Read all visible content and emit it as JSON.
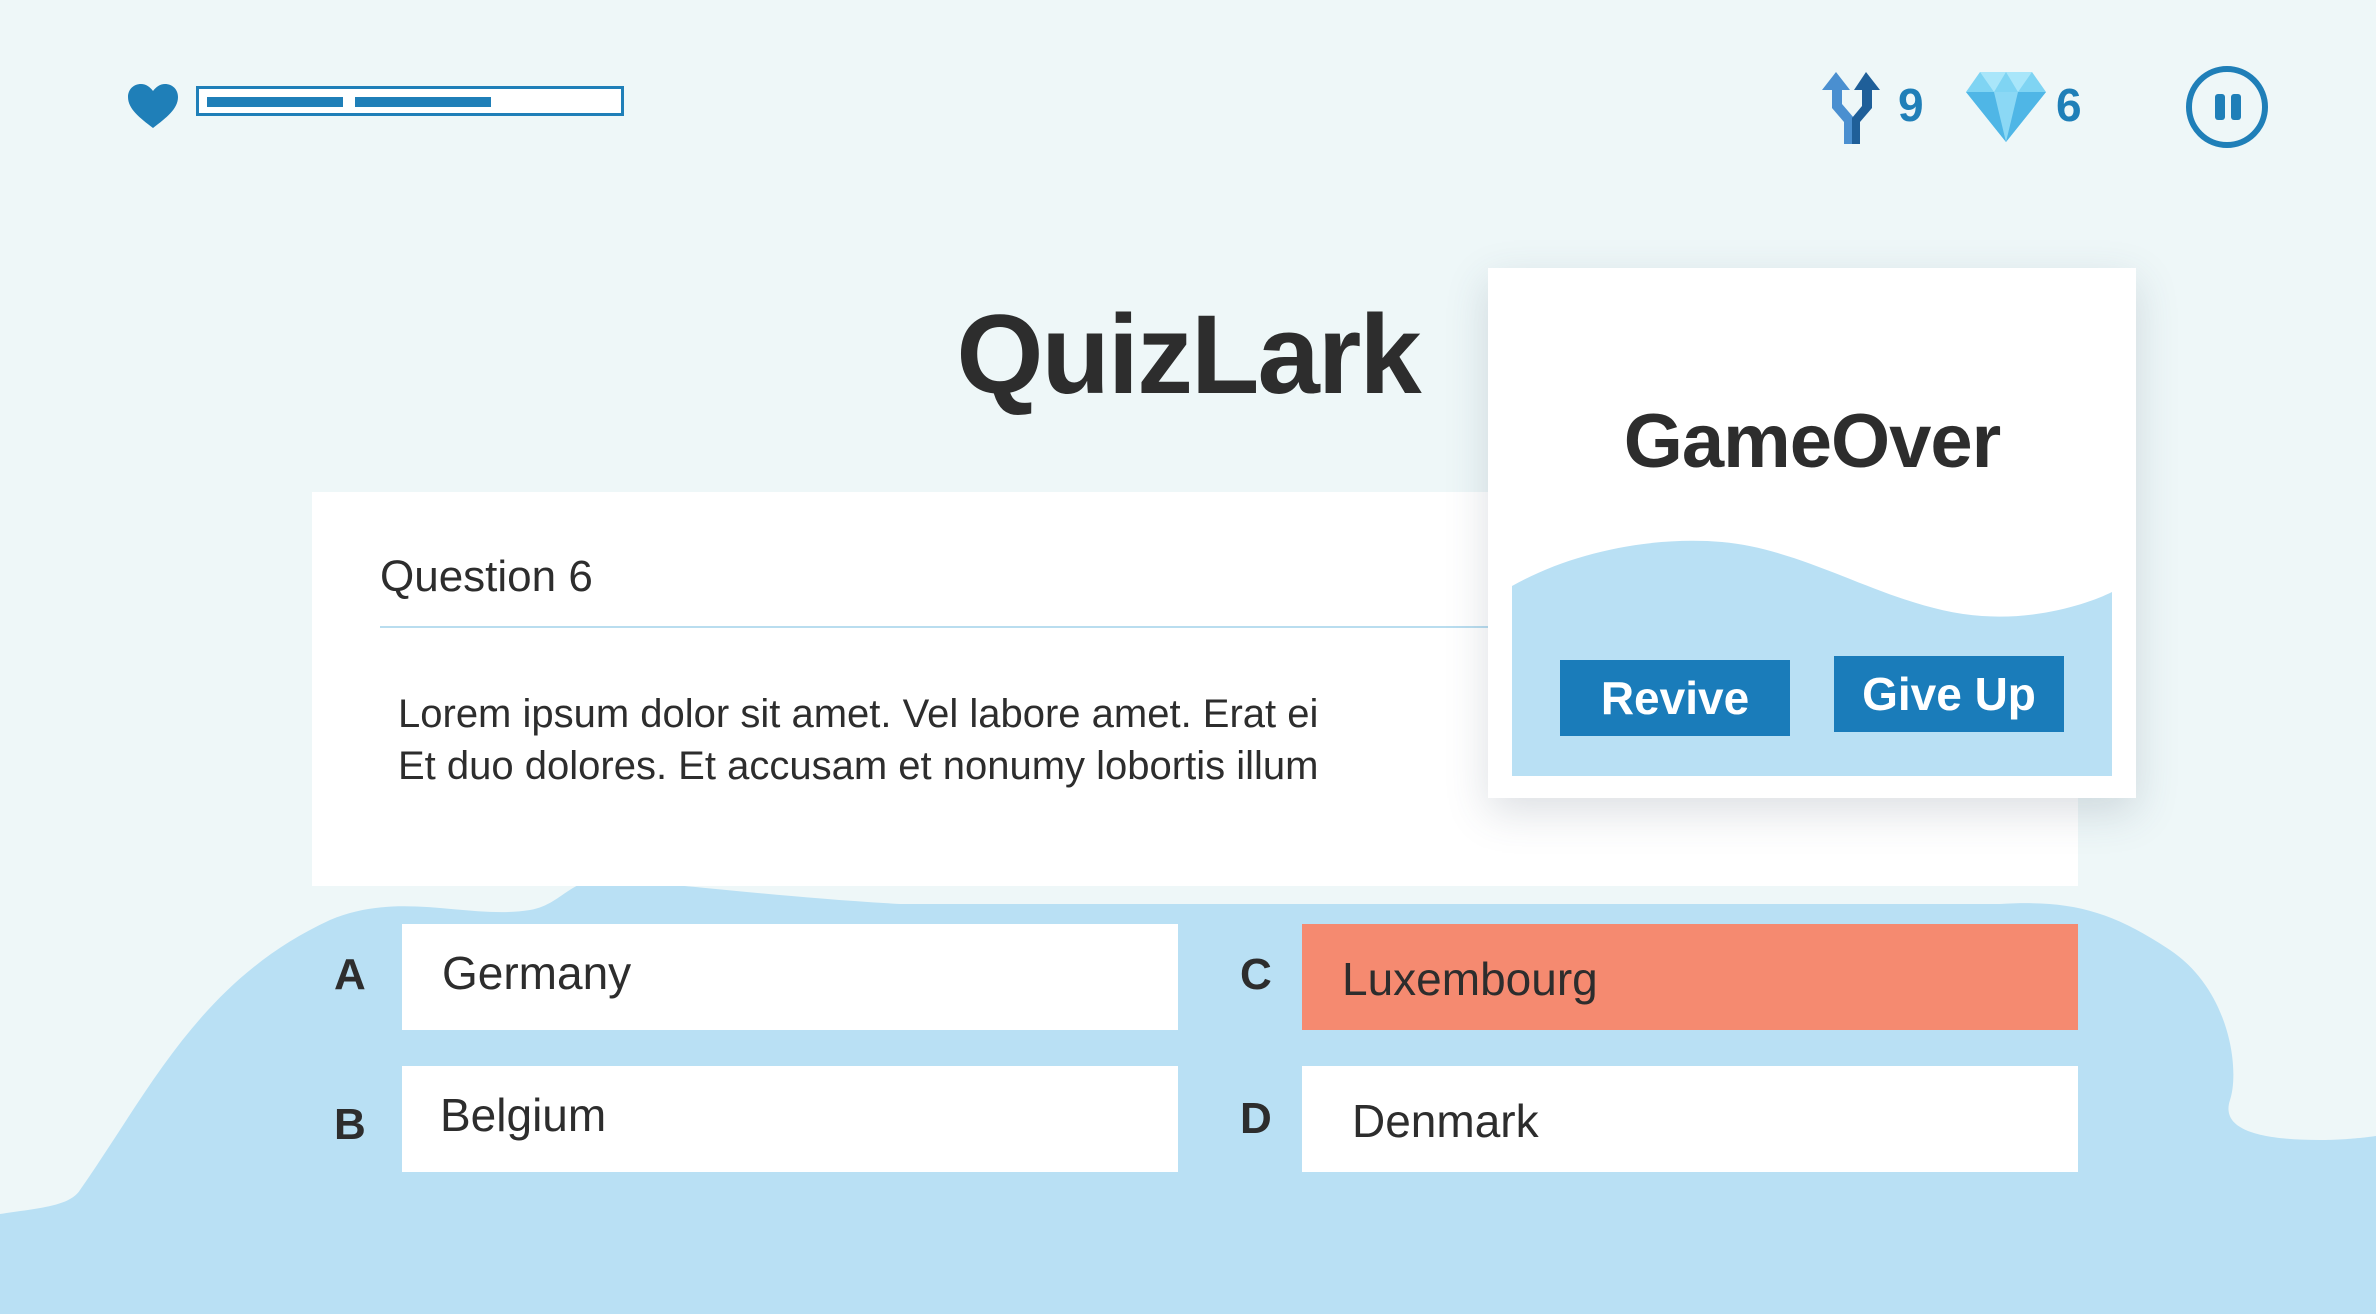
{
  "hud": {
    "health_fraction": 0.7,
    "skip_count": "9",
    "gem_count": "6",
    "skip_icon": "split-arrows-icon",
    "gem_icon": "diamond-icon"
  },
  "game_title": "QuizLark",
  "question": {
    "label": "Question 6",
    "line1": "Lorem ipsum dolor sit amet. Vel labore amet. Erat ei",
    "line2": "Et duo dolores. Et accusam et nonumy lobortis illum"
  },
  "answers": [
    {
      "letter": "A",
      "text": "Germany"
    },
    {
      "letter": "B",
      "text": "Belgium"
    },
    {
      "letter": "C",
      "text": "Luxembourg"
    },
    {
      "letter": "D",
      "text": "Denmark"
    }
  ],
  "modal": {
    "title": "GameOver",
    "revive_label": "Revive",
    "give_up_label": "Give Up"
  },
  "colors": {
    "background": "#eef7f8",
    "accent": "#1f7fb8",
    "light_blue": "#b9e0f4",
    "wrong_answer": "#f58a70"
  }
}
